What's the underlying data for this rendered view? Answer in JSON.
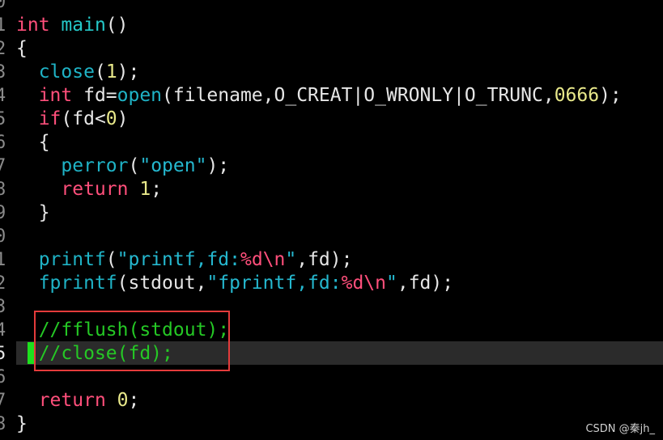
{
  "editor": {
    "gutter": [
      "0",
      "1",
      "2",
      "3",
      "4",
      "5",
      "6",
      "7",
      "8",
      "9",
      "0",
      "1",
      "2",
      "3",
      "4",
      "5",
      "6",
      "7",
      "8"
    ],
    "lines": [
      [],
      [
        {
          "t": "int",
          "c": "kw"
        },
        {
          "t": " "
        },
        {
          "t": "main",
          "c": "mainfn"
        },
        {
          "t": "()"
        }
      ],
      [
        {
          "t": "{"
        }
      ],
      [
        {
          "t": "  "
        },
        {
          "t": "close",
          "c": "fn"
        },
        {
          "t": "("
        },
        {
          "t": "1",
          "c": "num"
        },
        {
          "t": ");"
        }
      ],
      [
        {
          "t": "  "
        },
        {
          "t": "int",
          "c": "kw"
        },
        {
          "t": " fd="
        },
        {
          "t": "open",
          "c": "fn"
        },
        {
          "t": "(filename,O_CREAT|O_WRONLY|O_TRUNC,"
        },
        {
          "t": "0666",
          "c": "num"
        },
        {
          "t": ");"
        }
      ],
      [
        {
          "t": "  "
        },
        {
          "t": "if",
          "c": "kw"
        },
        {
          "t": "(fd<"
        },
        {
          "t": "0",
          "c": "num"
        },
        {
          "t": ")"
        }
      ],
      [
        {
          "t": "  {"
        }
      ],
      [
        {
          "t": "    "
        },
        {
          "t": "perror",
          "c": "fn"
        },
        {
          "t": "("
        },
        {
          "t": "\"open\"",
          "c": "str"
        },
        {
          "t": ");"
        }
      ],
      [
        {
          "t": "    "
        },
        {
          "t": "return",
          "c": "kw"
        },
        {
          "t": " "
        },
        {
          "t": "1",
          "c": "num"
        },
        {
          "t": ";"
        }
      ],
      [
        {
          "t": "  }"
        }
      ],
      [],
      [
        {
          "t": "  "
        },
        {
          "t": "printf",
          "c": "fn"
        },
        {
          "t": "("
        },
        {
          "t": "\"printf,fd:",
          "c": "str"
        },
        {
          "t": "%d\\n",
          "c": "esc"
        },
        {
          "t": "\"",
          "c": "str"
        },
        {
          "t": ",fd);"
        }
      ],
      [
        {
          "t": "  "
        },
        {
          "t": "fprintf",
          "c": "fn"
        },
        {
          "t": "(stdout,"
        },
        {
          "t": "\"fprintf,fd:",
          "c": "str"
        },
        {
          "t": "%d\\n",
          "c": "esc"
        },
        {
          "t": "\"",
          "c": "str"
        },
        {
          "t": ",fd);"
        }
      ],
      [],
      [
        {
          "t": "  "
        },
        {
          "t": "//fflush(stdout);",
          "c": "cm"
        }
      ],
      [
        {
          "t": "  "
        },
        {
          "t": "//close(fd);",
          "c": "cm"
        }
      ],
      [],
      [
        {
          "t": "  "
        },
        {
          "t": "return",
          "c": "kw"
        },
        {
          "t": " "
        },
        {
          "t": "0",
          "c": "num"
        },
        {
          "t": ";"
        }
      ],
      [
        {
          "t": "}"
        }
      ]
    ],
    "current_line_index": 15
  },
  "watermark": "CSDN @秦jh_"
}
